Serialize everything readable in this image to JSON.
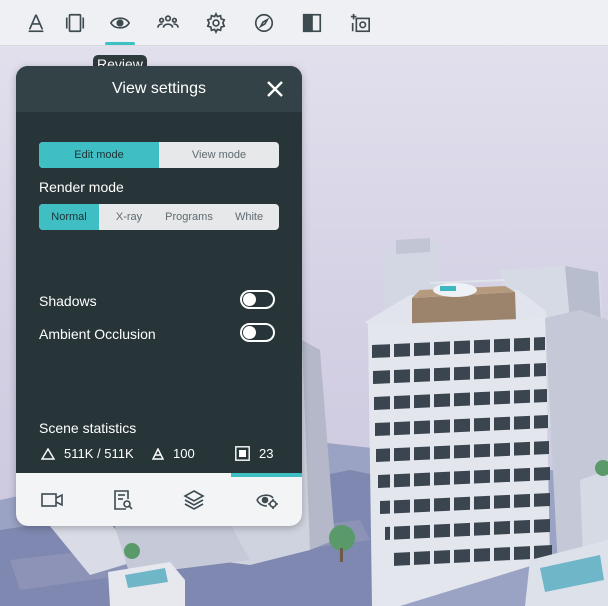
{
  "toolbar": {
    "tools": [
      {
        "icon": "measure-icon"
      },
      {
        "icon": "panels-icon"
      },
      {
        "icon": "eye-icon",
        "active": true
      },
      {
        "icon": "people-icon"
      },
      {
        "icon": "gear-icon"
      },
      {
        "icon": "compass-icon"
      },
      {
        "icon": "split-view-icon"
      },
      {
        "icon": "add-camera-icon"
      }
    ],
    "tooltip": "Review"
  },
  "panel": {
    "title": "View settings",
    "close_icon": "close-icon",
    "mode_options": [
      "Edit mode",
      "View mode"
    ],
    "mode_selected": "Edit mode",
    "render_mode_label": "Render mode",
    "render_options": [
      "Normal",
      "X-ray",
      "Programs",
      "White"
    ],
    "render_selected": "Normal",
    "shadows_label": "Shadows",
    "shadows_on": false,
    "ambient_occlusion_label": "Ambient Occlusion",
    "ambient_occlusion_on": false,
    "stats_label": "Scene statistics",
    "stats": {
      "triangles": "511K / 511K",
      "objects": "100",
      "items": "23"
    },
    "tabs": [
      {
        "icon": "camera-icon"
      },
      {
        "icon": "report-search-icon"
      },
      {
        "icon": "layers-icon"
      },
      {
        "icon": "view-settings-icon",
        "active": true
      }
    ]
  },
  "colors": {
    "accent": "#3fbfc3",
    "panel_bg": "#273539",
    "toolbar_bg": "#eef0f3"
  }
}
